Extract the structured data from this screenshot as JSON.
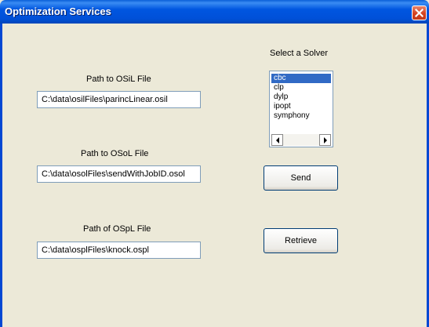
{
  "window": {
    "title": "Optimization Services"
  },
  "solver": {
    "label": "Select a Solver",
    "options": [
      "cbc",
      "clp",
      "dylp",
      "ipopt",
      "symphony"
    ],
    "selected": "cbc"
  },
  "osil": {
    "label": "Path to OSiL File",
    "value": "C:\\data\\osilFiles\\parincLinear.osil"
  },
  "osol": {
    "label": "Path to  OSoL File",
    "value": "C:\\data\\osolFiles\\sendWithJobID.osol"
  },
  "ospl": {
    "label": "Path of OSpL File",
    "value": "C:\\data\\osplFiles\\knock.ospl"
  },
  "buttons": {
    "send": "Send",
    "retrieve": "Retrieve"
  },
  "icons": {
    "close": "close-icon",
    "scroll_left": "arrow-left-icon",
    "scroll_right": "arrow-right-icon"
  }
}
